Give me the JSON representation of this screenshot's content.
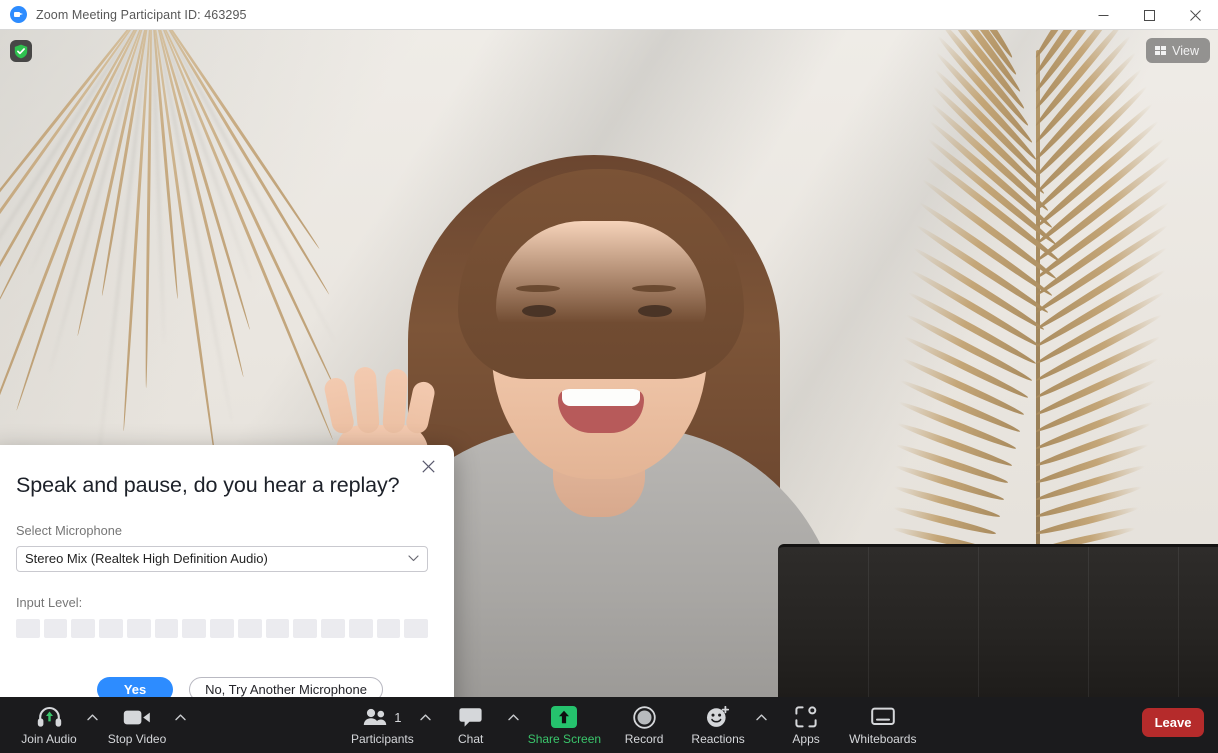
{
  "window": {
    "title": "Zoom Meeting Participant ID: 463295",
    "logo_icon": "zoom-logo-icon",
    "minimize_icon": "minimize-icon",
    "maximize_icon": "maximize-icon",
    "close_icon": "close-icon"
  },
  "stage": {
    "encryption_badge_icon": "shield-check-icon",
    "view_button": {
      "label": "View",
      "icon": "grid-view-icon"
    }
  },
  "dialog": {
    "title": "Speak and pause, do you hear a replay?",
    "close_icon": "close-icon",
    "microphone_label": "Select Microphone",
    "microphone_value": "Stereo Mix (Realtek High Definition Audio)",
    "microphone_options": [
      "Stereo Mix (Realtek High Definition Audio)"
    ],
    "chevron_icon": "chevron-down-icon",
    "input_level_label": "Input Level:",
    "input_level_segments": 15,
    "input_level_filled": 0,
    "yes_label": "Yes",
    "no_label": "No, Try Another Microphone"
  },
  "toolbar": {
    "items": [
      {
        "label": "Join Audio",
        "icon": "headset-audio-icon",
        "caret": true,
        "green_label": false
      },
      {
        "label": "Stop Video",
        "icon": "camera-icon",
        "caret": true,
        "green_label": false
      },
      {
        "label": "Participants",
        "icon": "participants-icon",
        "caret": true,
        "green_label": false,
        "count": "1"
      },
      {
        "label": "Chat",
        "icon": "chat-bubble-icon",
        "caret": true,
        "green_label": false
      },
      {
        "label": "Share Screen",
        "icon": "share-screen-icon",
        "caret": false,
        "green_label": true
      },
      {
        "label": "Record",
        "icon": "record-circle-icon",
        "caret": false,
        "green_label": false
      },
      {
        "label": "Reactions",
        "icon": "reactions-smiley-icon",
        "caret": true,
        "green_label": false
      },
      {
        "label": "Apps",
        "icon": "apps-icon",
        "caret": false,
        "green_label": false
      },
      {
        "label": "Whiteboards",
        "icon": "whiteboard-monitor-icon",
        "caret": false,
        "green_label": false
      }
    ],
    "leave_label": "Leave"
  },
  "colors": {
    "accent_blue": "#2d8cff",
    "share_green": "#25c26d",
    "leave_red": "#b52b2b",
    "toolbar_bg": "#1b1b1d",
    "encryption_green": "#2fc14f"
  }
}
